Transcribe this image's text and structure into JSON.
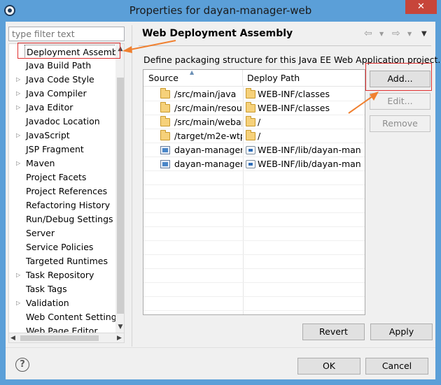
{
  "window": {
    "title": "Properties for dayan-manager-web",
    "close_label": "✕"
  },
  "filter": {
    "placeholder": "type filter text"
  },
  "tree": {
    "items": [
      {
        "label": "Deployment Assembly",
        "expandable": false,
        "selected": true
      },
      {
        "label": "Java Build Path",
        "expandable": false
      },
      {
        "label": "Java Code Style",
        "expandable": true
      },
      {
        "label": "Java Compiler",
        "expandable": true
      },
      {
        "label": "Java Editor",
        "expandable": true
      },
      {
        "label": "Javadoc Location",
        "expandable": false
      },
      {
        "label": "JavaScript",
        "expandable": true
      },
      {
        "label": "JSP Fragment",
        "expandable": false
      },
      {
        "label": "Maven",
        "expandable": true
      },
      {
        "label": "Project Facets",
        "expandable": false
      },
      {
        "label": "Project References",
        "expandable": false
      },
      {
        "label": "Refactoring History",
        "expandable": false
      },
      {
        "label": "Run/Debug Settings",
        "expandable": false
      },
      {
        "label": "Server",
        "expandable": false
      },
      {
        "label": "Service Policies",
        "expandable": false
      },
      {
        "label": "Targeted Runtimes",
        "expandable": false
      },
      {
        "label": "Task Repository",
        "expandable": true
      },
      {
        "label": "Task Tags",
        "expandable": false
      },
      {
        "label": "Validation",
        "expandable": true
      },
      {
        "label": "Web Content Settings",
        "expandable": false
      },
      {
        "label": "Web Page Editor",
        "expandable": false
      }
    ]
  },
  "page": {
    "title": "Web Deployment Assembly",
    "description": "Define packaging structure for this Java EE Web Application project.",
    "table": {
      "columns": [
        "Source",
        "Deploy Path"
      ],
      "rows": [
        {
          "source": "/src/main/java",
          "source_icon": "folder",
          "deploy": "WEB-INF/classes",
          "deploy_icon": "folder"
        },
        {
          "source": "/src/main/resour",
          "source_icon": "folder",
          "deploy": "WEB-INF/classes",
          "deploy_icon": "folder"
        },
        {
          "source": "/src/main/webap",
          "source_icon": "folder",
          "deploy": "/",
          "deploy_icon": "folder"
        },
        {
          "source": "/target/m2e-wtp,",
          "source_icon": "folder",
          "deploy": "/",
          "deploy_icon": "folder"
        },
        {
          "source": "dayan-manager-",
          "source_icon": "maven-project",
          "deploy": "WEB-INF/lib/dayan-man",
          "deploy_icon": "jar"
        },
        {
          "source": "dayan-manager-",
          "source_icon": "maven-project",
          "deploy": "WEB-INF/lib/dayan-man",
          "deploy_icon": "jar"
        }
      ]
    },
    "buttons": {
      "add": "Add...",
      "edit": "Edit...",
      "remove": "Remove",
      "revert": "Revert",
      "apply": "Apply"
    }
  },
  "footer": {
    "help": "?",
    "ok": "OK",
    "cancel": "Cancel"
  },
  "colors": {
    "titlebar": "#5b9fd8",
    "annotation": "#e03030",
    "arrow": "#f08030"
  }
}
